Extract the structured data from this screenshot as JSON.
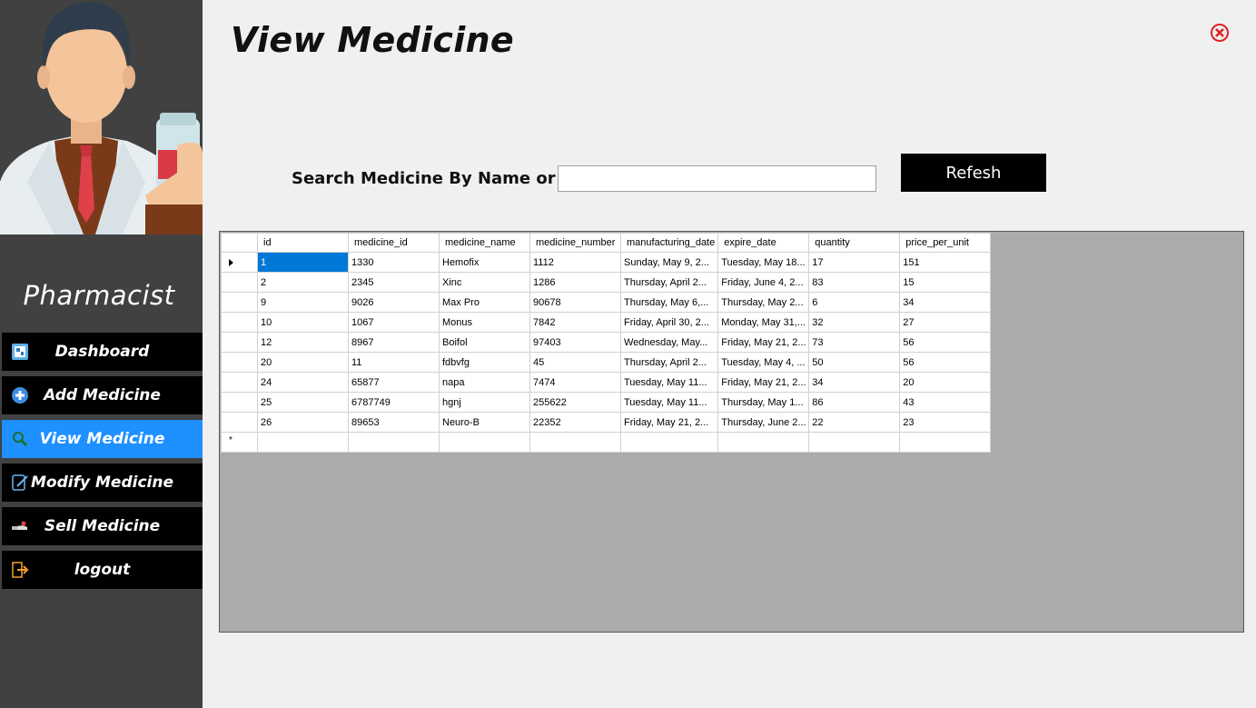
{
  "sidebar": {
    "role_title": "Pharmacist",
    "items": [
      {
        "label": "Dashboard",
        "icon": "dashboard-icon",
        "active": false
      },
      {
        "label": "Add Medicine",
        "icon": "plus-circle-icon",
        "active": false
      },
      {
        "label": "View Medicine",
        "icon": "magnifier-icon",
        "active": true
      },
      {
        "label": "Modify Medicine",
        "icon": "edit-icon",
        "active": false
      },
      {
        "label": "Sell Medicine",
        "icon": "hand-pill-icon",
        "active": false
      },
      {
        "label": "logout",
        "icon": "logout-icon",
        "active": false
      }
    ],
    "active_color": "#1e90ff"
  },
  "main": {
    "title": "View Medicine",
    "search_label": "Search Medicine By Name or ID",
    "search_value": "",
    "refresh_label": "Refesh"
  },
  "grid": {
    "columns": [
      "id",
      "medicine_id",
      "medicine_name",
      "medicine_number",
      "manufacturing_date",
      "expire_date",
      "quantity",
      "price_per_unit"
    ],
    "rows": [
      [
        "1",
        "1330",
        "Hemofix",
        "1112",
        "Sunday, May 9, 2...",
        "Tuesday, May 18...",
        "17",
        "151"
      ],
      [
        "2",
        "2345",
        "Xinc",
        "1286",
        "Thursday, April 2...",
        "Friday, June 4, 2...",
        "83",
        "15"
      ],
      [
        "9",
        "9026",
        "Max Pro",
        "90678",
        "Thursday, May 6,...",
        "Thursday, May 2...",
        "6",
        "34"
      ],
      [
        "10",
        "1067",
        "Monus",
        "7842",
        "Friday, April 30, 2...",
        "Monday, May 31,...",
        "32",
        "27"
      ],
      [
        "12",
        "8967",
        "Boifol",
        "97403",
        "Wednesday, May...",
        "Friday, May 21, 2...",
        "73",
        "56"
      ],
      [
        "20",
        "11",
        "fdbvfg",
        "45",
        "Thursday, April 2...",
        "Tuesday, May 4, ...",
        "50",
        "56"
      ],
      [
        "24",
        "65877",
        "napa",
        "7474",
        "Tuesday, May 11...",
        "Friday, May 21, 2...",
        "34",
        "20"
      ],
      [
        "25",
        "6787749",
        "hgnj",
        "255622",
        "Tuesday, May 11...",
        "Thursday, May 1...",
        "86",
        "43"
      ],
      [
        "26",
        "89653",
        "Neuro-B",
        "22352",
        "Friday, May 21, 2...",
        "Thursday, June 2...",
        "22",
        "23"
      ]
    ],
    "new_row_marker": "*"
  }
}
